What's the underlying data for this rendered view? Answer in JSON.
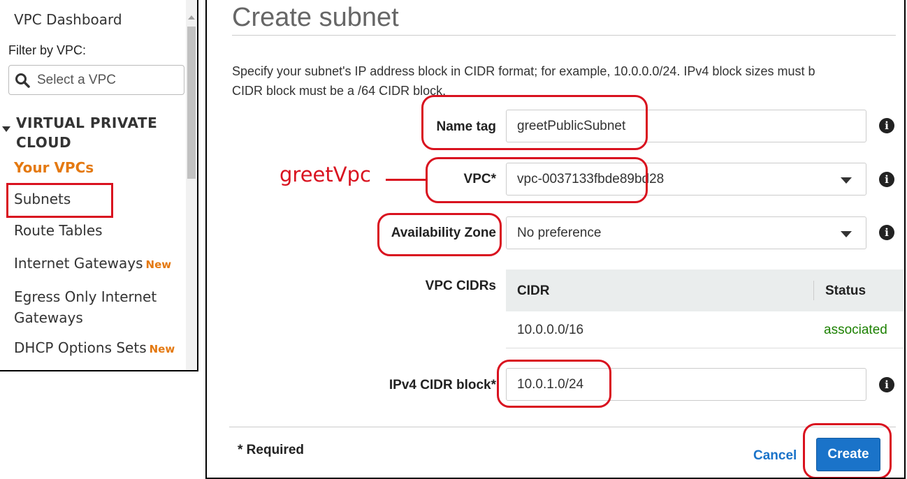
{
  "sidebar": {
    "dashboard": "VPC Dashboard",
    "filter_label": "Filter by VPC:",
    "search_placeholder": "Select a VPC",
    "section_title": "VIRTUAL PRIVATE CLOUD",
    "items": [
      {
        "label": "Your VPCs",
        "active": true,
        "badge": ""
      },
      {
        "label": "Subnets",
        "active": false,
        "badge": ""
      },
      {
        "label": "Route Tables",
        "active": false,
        "badge": ""
      },
      {
        "label": "Internet Gateways",
        "active": false,
        "badge": "New"
      },
      {
        "label": "Egress Only Internet Gateways",
        "active": false,
        "badge": ""
      },
      {
        "label": "DHCP Options Sets",
        "active": false,
        "badge": "New"
      }
    ]
  },
  "dialog": {
    "title": "Create subnet",
    "description_line1": "Specify your subnet's IP address block in CIDR format; for example, 10.0.0.0/24. IPv4 block sizes must b",
    "description_line2": "CIDR block must be a /64 CIDR block.",
    "fields": {
      "name_tag": {
        "label": "Name tag",
        "value": "greetPublicSubnet"
      },
      "vpc": {
        "label": "VPC*",
        "value": "vpc-0037133fbde89bd28"
      },
      "availability_zone": {
        "label": "Availability Zone",
        "value": "No preference"
      },
      "vpc_cidrs": {
        "label": "VPC CIDRs"
      },
      "ipv4_cidr": {
        "label": "IPv4 CIDR block*",
        "value": "10.0.1.0/24"
      }
    },
    "cidr_table": {
      "headers": [
        "CIDR",
        "Status"
      ],
      "rows": [
        {
          "cidr": "10.0.0.0/16",
          "status": "associated"
        }
      ]
    },
    "footer": {
      "required_note": "* Required",
      "cancel_label": "Cancel",
      "create_label": "Create"
    }
  },
  "annotation": {
    "text": "greetVpc",
    "color": "#d9121f"
  },
  "colors": {
    "accent_orange": "#e47911",
    "primary_blue": "#1a73c9",
    "status_green": "#1d8102",
    "annotation_red": "#d9121f"
  }
}
